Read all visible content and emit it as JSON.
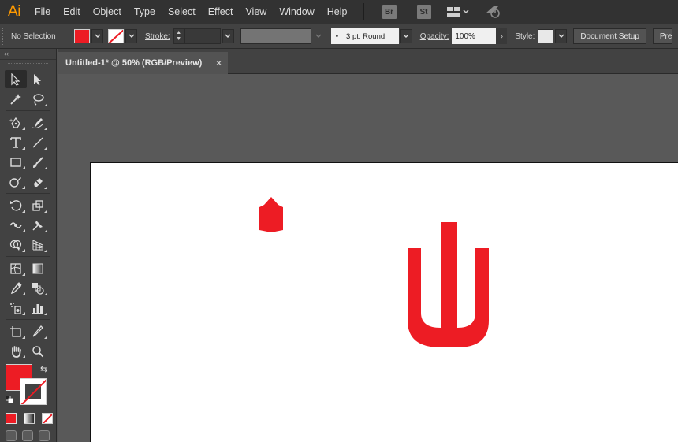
{
  "app": {
    "logo": "Ai",
    "accent": "#ff9a00"
  },
  "menu": [
    "File",
    "Edit",
    "Object",
    "Type",
    "Select",
    "Effect",
    "View",
    "Window",
    "Help"
  ],
  "menubar_apps": [
    "Br",
    "St"
  ],
  "control": {
    "selection": "No Selection",
    "fill_color": "#ed1c24",
    "stroke_label": "Stroke:",
    "profile": "3 pt. Round",
    "opacity_label": "Opacity:",
    "opacity_value": "100%",
    "style_label": "Style:",
    "document_setup": "Document Setup",
    "preferences_partial": "Pre"
  },
  "toolbar": {
    "collapse": "‹‹",
    "fill": "#ed1c24",
    "stroke": "none"
  },
  "document": {
    "tab_title": "Untitled-1* @ 50% (RGB/Preview)",
    "close": "×"
  },
  "artwork": {
    "color": "#ed1c24"
  }
}
